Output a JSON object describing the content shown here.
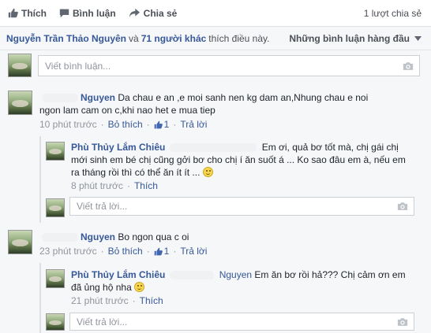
{
  "actions": {
    "like": "Thích",
    "comment": "Bình luận",
    "share": "Chia sẻ",
    "shares_count": "1 lượt chia sẻ"
  },
  "likes": {
    "person": "Nguyễn Trần Thảo Nguyên",
    "conj": "và",
    "others": "71 người khác",
    "suffix": "thích điều này.",
    "sort_label": "Những bình luận hàng đầu"
  },
  "composer": {
    "placeholder": "Viết bình luận..."
  },
  "comments": [
    {
      "author": "Nguyen",
      "text": "Da chau e an ,e moi sanh nen kg dam an,Nhung chau e noi ngon lam cam on c,khi nao het e mua tiep",
      "time": "10 phút trước",
      "unlike": "Bỏ thích",
      "like_count": "1",
      "reply": "Trả lời",
      "replies": [
        {
          "author": "Phù Thủy Lắm Chiêu",
          "text": "Em ơi, quả bơ tốt mà, chị gái chị mới sinh em bé chị cũng gởi bơ cho chị í ăn suốt á ... Ko sao đâu em à, nếu em ra tháng rồi thì có thể ăn ít ít ...",
          "time": "8 phút trước",
          "like": "Thích"
        }
      ],
      "reply_placeholder": "Viết trả lời..."
    },
    {
      "author": "Nguyen",
      "text": "Bo ngon qua c oi",
      "time": "23 phút trước",
      "unlike": "Bỏ thích",
      "like_count": "1",
      "reply": "Trả lời",
      "replies": [
        {
          "author": "Phù Thủy Lắm Chiêu",
          "mention": "Nguyen",
          "text": "Em ăn bơ rồi hả??? Chị cảm ơn em đã ủng hộ nha",
          "time": "21 phút trước",
          "like": "Thích"
        }
      ],
      "reply_placeholder": "Viết trả lời..."
    }
  ],
  "colors": {
    "link": "#365899",
    "meta": "#90949c",
    "text": "#1d2129",
    "bg": "#f6f7f9"
  }
}
